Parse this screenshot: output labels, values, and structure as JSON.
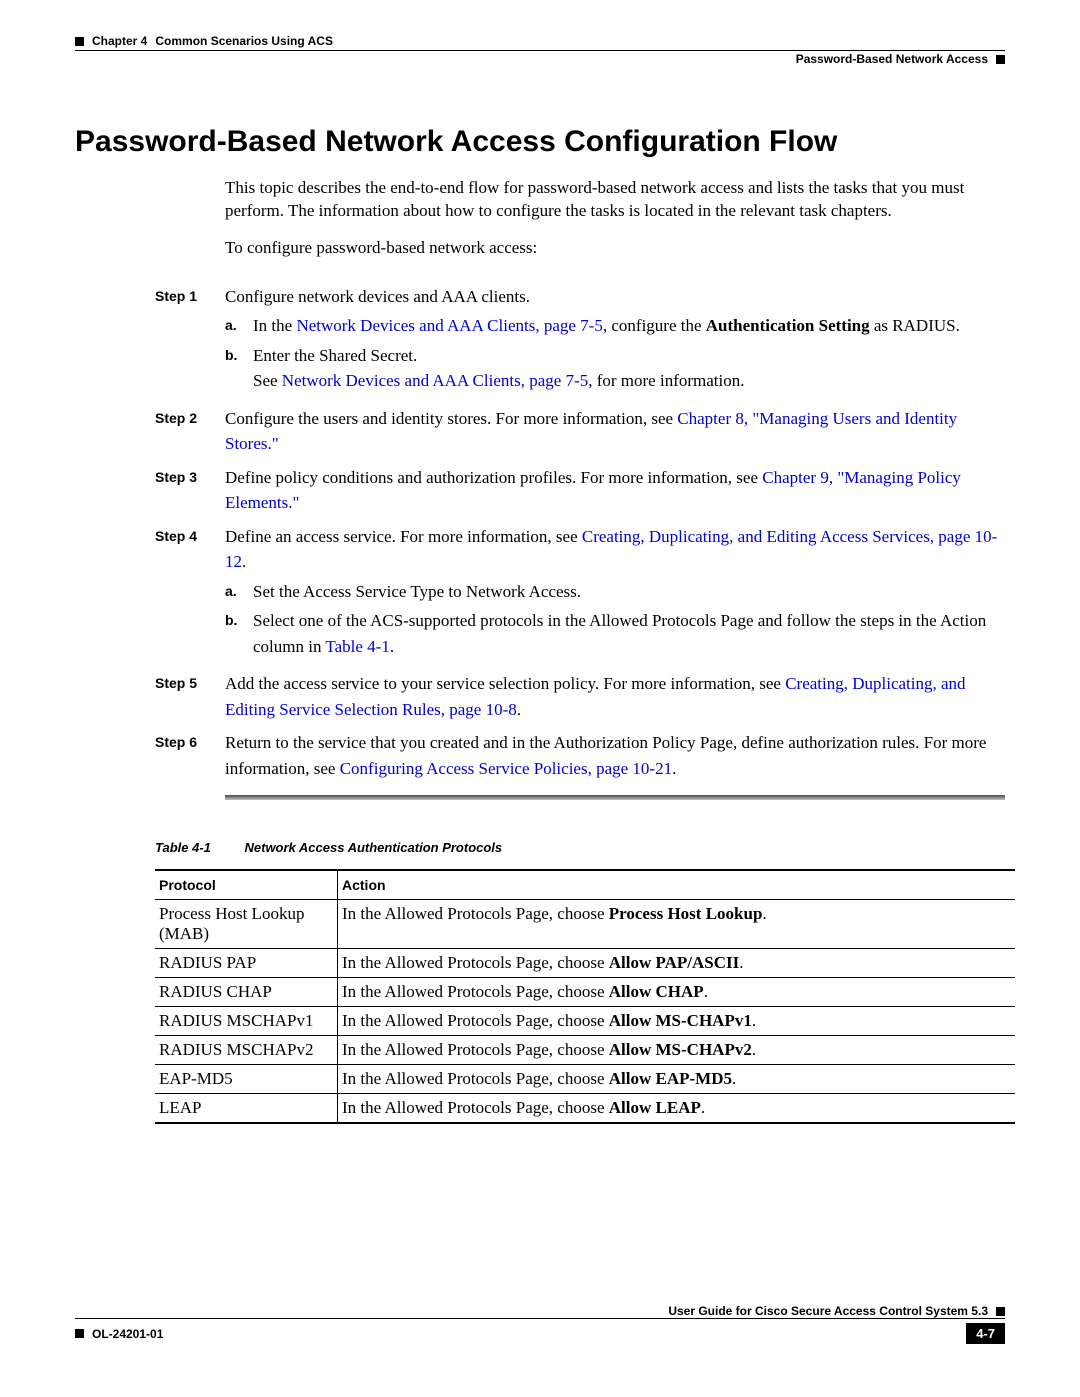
{
  "header": {
    "chapter_label": "Chapter 4",
    "chapter_title": "Common Scenarios Using ACS",
    "section_title": "Password-Based Network Access"
  },
  "title": "Password-Based Network Access Configuration Flow",
  "intro": {
    "p1": "This topic describes the end-to-end flow for password-based network access and lists the tasks that you must perform. The information about how to configure the tasks is located in the relevant task chapters.",
    "p2": "To configure password-based network access:"
  },
  "steps": {
    "s1": {
      "label": "Step 1",
      "text": "Configure network devices and AAA clients.",
      "a_prefix": "In the ",
      "a_link": "Network Devices and AAA Clients, page 7-5",
      "a_mid": ", configure the ",
      "a_bold": "Authentication Setting",
      "a_suffix": " as RADIUS.",
      "b_text": "Enter the Shared Secret.",
      "b_see_prefix": "See ",
      "b_see_link": "Network Devices and AAA Clients, page 7-5",
      "b_see_suffix": ", for more information."
    },
    "s2": {
      "label": "Step 2",
      "text_prefix": "Configure the users and identity stores. For more information, see ",
      "link": "Chapter 8, \"Managing Users and Identity Stores.\""
    },
    "s3": {
      "label": "Step 3",
      "text_prefix": "Define policy conditions and authorization profiles. For more information, see ",
      "link": "Chapter 9, \"Managing Policy Elements.\""
    },
    "s4": {
      "label": "Step 4",
      "text_prefix": "Define an access service. For more information, see ",
      "link": "Creating, Duplicating, and Editing Access Services, page 10-12",
      "suffix": ".",
      "a_text": "Set the Access Service Type to Network Access.",
      "b_prefix": "Select one of the ACS-supported protocols in the Allowed Protocols Page and follow the steps in the Action column in ",
      "b_link": "Table 4-1",
      "b_suffix": "."
    },
    "s5": {
      "label": "Step 5",
      "text_prefix": "Add the access service to your service selection policy. For more information, see ",
      "link": "Creating, Duplicating, and Editing Service Selection Rules, page 10-8",
      "suffix": "."
    },
    "s6": {
      "label": "Step 6",
      "text_prefix": "Return to the service that you created and in the Authorization Policy Page, define authorization rules. For more information, see ",
      "link": "Configuring Access Service Policies, page 10-21",
      "suffix": "."
    }
  },
  "table": {
    "caption_num": "Table 4-1",
    "caption_title": "Network Access Authentication Protocols",
    "col1": "Protocol",
    "col2": "Action",
    "r1p": "Process Host Lookup (MAB)",
    "r1a_pre": "In the Allowed Protocols Page, choose ",
    "r1a_bold": "Process Host Lookup",
    "r1a_suf": ".",
    "r2p": "RADIUS PAP",
    "r2a_pre": "In the Allowed Protocols Page, choose ",
    "r2a_bold": "Allow PAP/ASCII",
    "r2a_suf": ".",
    "r3p": "RADIUS CHAP",
    "r3a_pre": "In the Allowed Protocols Page, choose ",
    "r3a_bold": "Allow CHAP",
    "r3a_suf": ".",
    "r4p": "RADIUS MSCHAPv1",
    "r4a_pre": "In the Allowed Protocols Page, choose ",
    "r4a_bold": "Allow MS-CHAPv1",
    "r4a_suf": ".",
    "r5p": "RADIUS MSCHAPv2",
    "r5a_pre": "In the Allowed Protocols Page, choose ",
    "r5a_bold": "Allow MS-CHAPv2",
    "r5a_suf": ".",
    "r6p": "EAP-MD5",
    "r6a_pre": "In the Allowed Protocols Page, choose ",
    "r6a_bold": "Allow EAP-MD5",
    "r6a_suf": ".",
    "r7p": "LEAP",
    "r7a_pre": "In the Allowed Protocols Page, choose ",
    "r7a_bold": "Allow LEAP",
    "r7a_suf": "."
  },
  "footer": {
    "guide": "User Guide for Cisco Secure Access Control System 5.3",
    "doc_id": "OL-24201-01",
    "page": "4-7"
  }
}
